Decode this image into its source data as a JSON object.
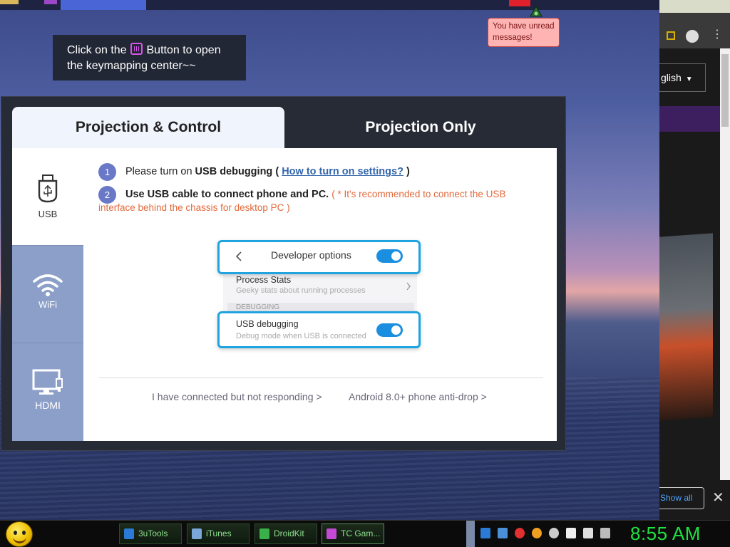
{
  "tooltip": {
    "text": "You have unread messages!"
  },
  "hint": {
    "pre": "Click on the",
    "post": "Button to open the keymapping center~~"
  },
  "dialog": {
    "tabs": [
      {
        "label": "Projection & Control",
        "active": true
      },
      {
        "label": "Projection Only",
        "active": false
      }
    ],
    "sidebar": [
      {
        "label": "USB",
        "active": true
      },
      {
        "label": "WiFi",
        "active": false
      },
      {
        "label": "HDMI",
        "active": false
      }
    ],
    "steps": {
      "step1": {
        "num": "1",
        "prefix": "Please turn on ",
        "bold": "USB debugging",
        "open": " ( ",
        "link": "How to turn on settings?",
        "close": " )"
      },
      "step2": {
        "num": "2",
        "bold": "Use USB cable to connect phone and PC.",
        "note": "( * It's recommended to connect the USB",
        "note_cont": "interface behind the chassis for desktop PC )"
      }
    },
    "illustration": {
      "header": "Developer options",
      "process_title": "Process Stats",
      "process_sub": "Geeky stats about running processes",
      "section": "DEBUGGING",
      "usb_title": "USB debugging",
      "usb_sub": "Debug mode when USB is connected"
    },
    "help_links": {
      "not_responding": "I have connected but not responding >",
      "anti_drop": "Android 8.0+ phone anti-drop >"
    }
  },
  "browser": {
    "language": "glish",
    "show_all": "Show all"
  },
  "taskbar": {
    "apps": [
      {
        "label": "3uTools",
        "color": "#2a7ad6"
      },
      {
        "label": "iTunes",
        "color": "#7aa8d8"
      },
      {
        "label": "DroidKit",
        "color": "#3ab04a"
      },
      {
        "label": "TC Gam...",
        "color": "#c44ad6"
      }
    ],
    "clock": "8:55 AM"
  }
}
